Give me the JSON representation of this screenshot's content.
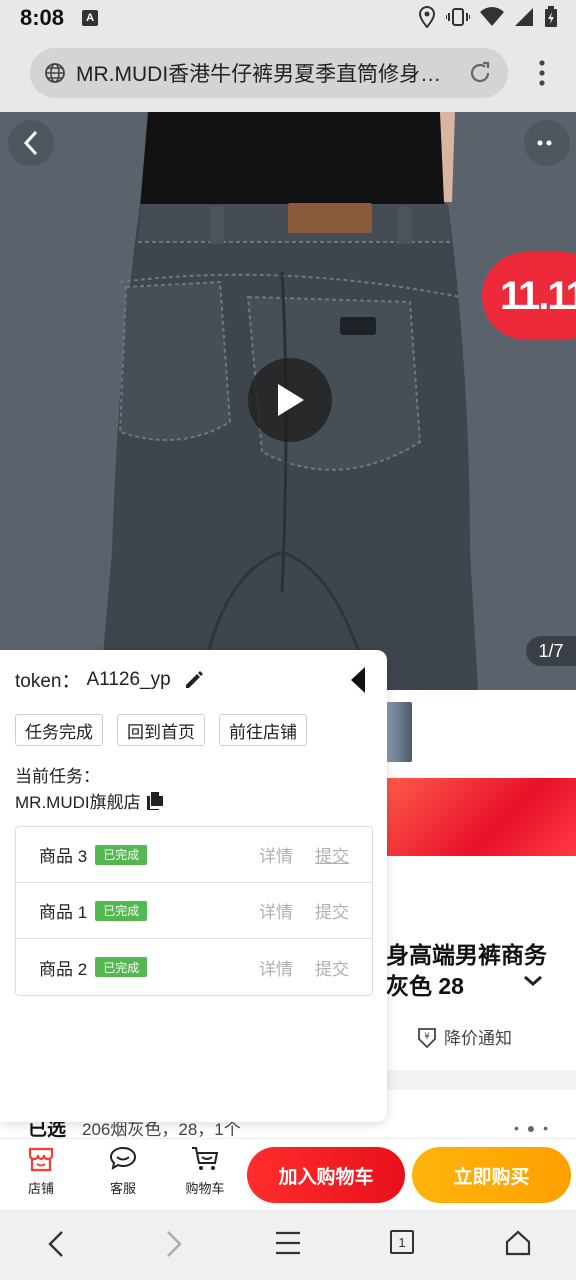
{
  "status_bar": {
    "time": "8:08",
    "badge": "A"
  },
  "browser": {
    "url_title": "MR.MUDI香港牛仔裤男夏季直筒修身…"
  },
  "hero": {
    "page_indicator": "1/7",
    "promo_badge": "11.11"
  },
  "panel": {
    "token_label": "token：",
    "token_value": "A1126_yp",
    "buttons": [
      "任务完成",
      "回到首页",
      "前往店铺"
    ],
    "current_task_label": "当前任务：",
    "current_task_value": "MR.MUDI旗舰店",
    "tasks": [
      {
        "name": "商品 3",
        "status": "已完成",
        "detail": "详情",
        "submit": "提交"
      },
      {
        "name": "商品 1",
        "status": "已完成",
        "detail": "详情",
        "submit": "提交"
      },
      {
        "name": "商品 2",
        "status": "已完成",
        "detail": "详情",
        "submit": "提交"
      }
    ]
  },
  "product": {
    "title_line1": "身高端男裤商务",
    "title_line2": "灰色 28",
    "price_notify": "降价通知",
    "selected_label": "已选",
    "selected_value": "206烟灰色，28，1个"
  },
  "action_bar": {
    "store": "店铺",
    "service": "客服",
    "cart": "购物车",
    "add_to_cart": "加入购物车",
    "buy_now": "立即购买"
  },
  "nav": {
    "tabs_count": "1"
  },
  "colors": {
    "accent_red": "#e8101a",
    "accent_orange": "#ffa000",
    "done_green": "#52b84f"
  }
}
